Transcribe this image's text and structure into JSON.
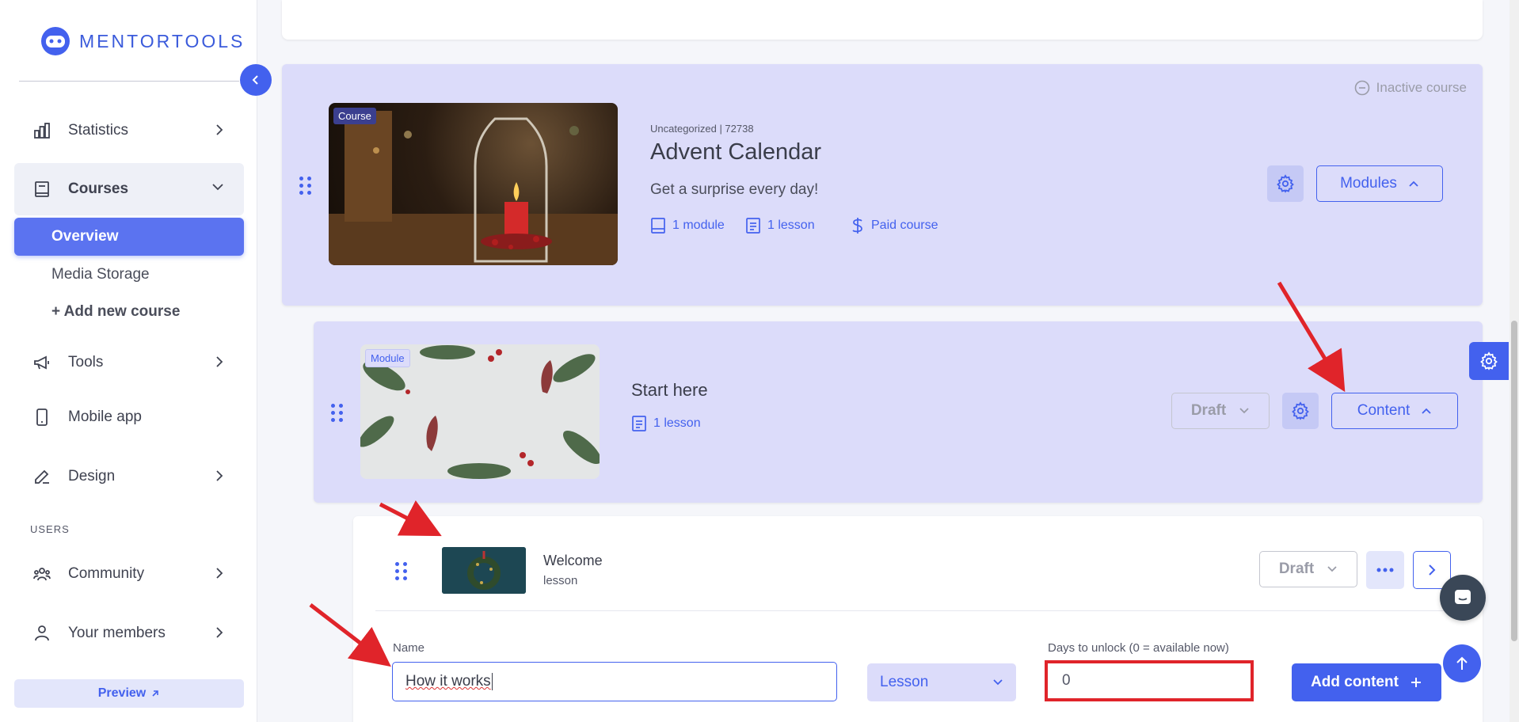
{
  "brand": {
    "name": "MENTORTOOLS",
    "accent": "#4361ee"
  },
  "sidebar": {
    "items": [
      {
        "label": "Statistics",
        "icon": "bar-chart-icon"
      },
      {
        "label": "Courses",
        "icon": "book-icon"
      },
      {
        "label": "Tools",
        "icon": "megaphone-icon"
      },
      {
        "label": "Mobile app",
        "icon": "phone-icon"
      },
      {
        "label": "Design",
        "icon": "pencil-icon"
      },
      {
        "label": "Community",
        "icon": "users-icon"
      },
      {
        "label": "Your members",
        "icon": "user-icon"
      }
    ],
    "courses_sub": {
      "overview": "Overview",
      "media_storage": "Media Storage",
      "add_new": "+ Add new course"
    },
    "users_section": "USERS",
    "preview": "Preview"
  },
  "course": {
    "tag": "Course",
    "status": "Inactive course",
    "meta_top": "Uncategorized | 72738",
    "title": "Advent Calendar",
    "subtitle": "Get a surprise every day!",
    "modules": "1 module",
    "lessons": "1 lesson",
    "pricing": "Paid course",
    "modules_button": "Modules"
  },
  "module": {
    "tag": "Module",
    "title": "Start here",
    "lessons": "1 lesson",
    "draft_button": "Draft",
    "content_button": "Content"
  },
  "lesson": {
    "title": "Welcome",
    "type": "lesson",
    "draft_button": "Draft"
  },
  "new_content_form": {
    "name_label": "Name",
    "name_value": "How it works",
    "type_value": "Lesson",
    "days_label": "Days to unlock (0 = available now)",
    "days_value": "0",
    "add_button": "Add content"
  }
}
